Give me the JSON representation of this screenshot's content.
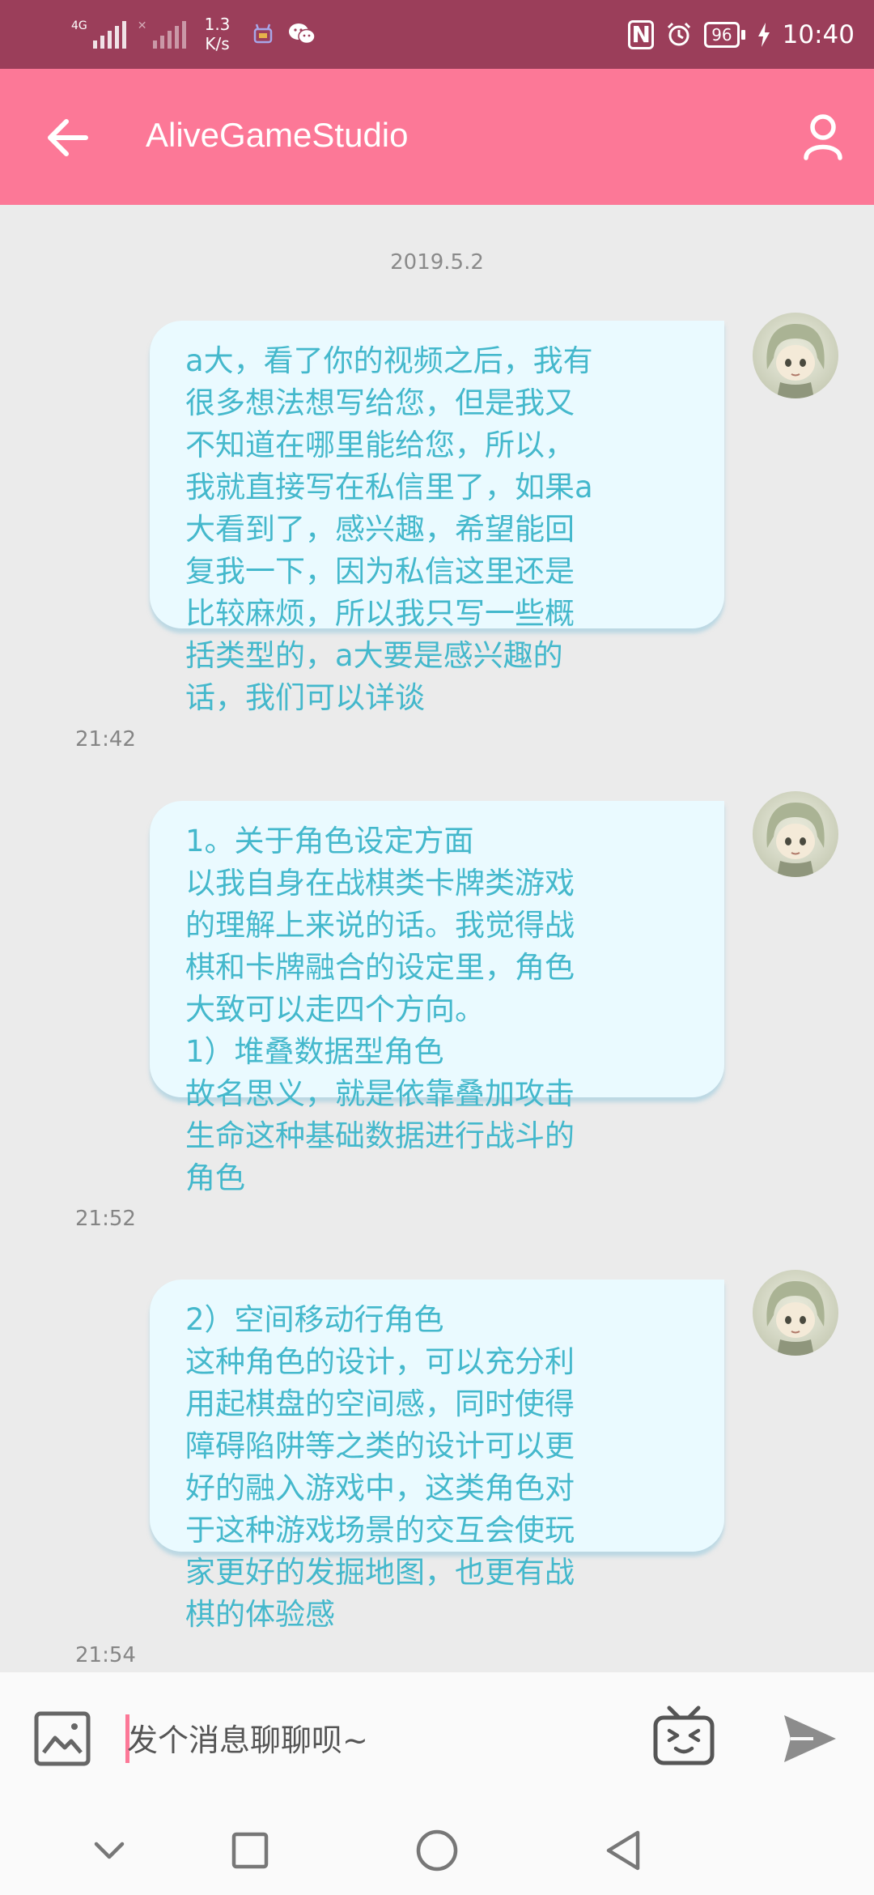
{
  "status_bar": {
    "network_label": "4G",
    "speed_value": "1.3",
    "speed_unit": "K/s",
    "battery": "96",
    "time": "10:40",
    "icons": [
      "signal-4g-icon",
      "signal-no-sim-icon",
      "app-notification-icon",
      "wechat-icon",
      "nfc-icon",
      "alarm-icon",
      "battery-icon",
      "charging-icon"
    ]
  },
  "header": {
    "title": "AliveGameStudio",
    "back_icon": "arrow-left-icon",
    "profile_icon": "user-icon"
  },
  "chat": {
    "date": "2019.5.2",
    "messages": [
      {
        "text": "a大，看了你的视频之后，我有\n很多想法想写给您，但是我又\n不知道在哪里能给您，所以，\n我就直接写在私信里了，如果a\n大看到了，感兴趣，希望能回\n复我一下，因为私信这里还是\n比较麻烦，所以我只写一些概\n括类型的，a大要是感兴趣的\n话，我们可以详谈",
        "time": "21:42"
      },
      {
        "text": "1。关于角色设定方面\n以我自身在战棋类卡牌类游戏\n的理解上来说的话。我觉得战\n棋和卡牌融合的设定里，角色\n大致可以走四个方向。\n1）堆叠数据型角色\n故名思义，就是依靠叠加攻击\n生命这种基础数据进行战斗的\n角色",
        "time": "21:52"
      },
      {
        "text": "2）空间移动行角色\n这种角色的设计，可以充分利\n用起棋盘的空间感，同时使得\n障碍陷阱等之类的设计可以更\n好的融入游戏中，这类角色对\n于这种游戏场景的交互会使玩\n家更好的发掘地图，也更有战\n棋的体验感",
        "time": "21:54"
      }
    ]
  },
  "input_bar": {
    "placeholder": "发个消息聊聊呗~",
    "value": "",
    "image_icon": "image-icon",
    "emoji_icon": "emoji-tv-icon",
    "send_icon": "send-icon"
  },
  "nav_bar": {
    "icons": [
      "chevron-down-icon",
      "square-recents-icon",
      "circle-home-icon",
      "triangle-back-icon"
    ]
  },
  "colors": {
    "status_bar_bg": "#9b3e5a",
    "header_bg": "#fc7897",
    "chat_bg": "#ebebeb",
    "bubble_bg": "#eafaff",
    "bubble_text": "#44b8cc"
  }
}
